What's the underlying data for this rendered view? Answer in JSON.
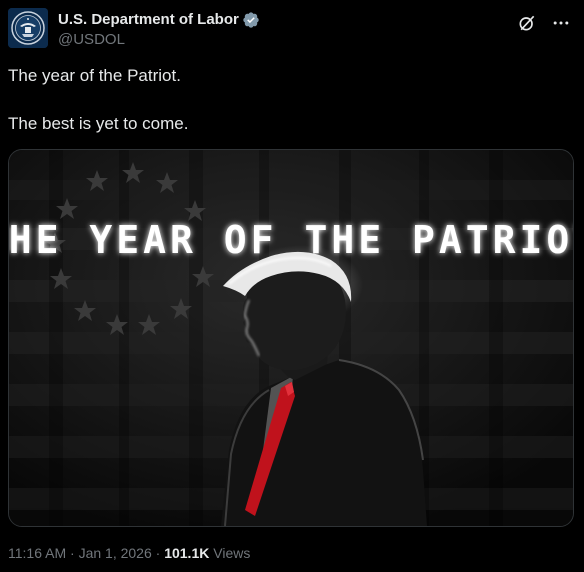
{
  "account": {
    "display_name": "U.S. Department of Labor",
    "handle": "@USDOL",
    "verified_icon": "verified-badge-icon",
    "avatar_icon": "department-of-labor-seal"
  },
  "header_actions": {
    "grok_icon": "grok-icon",
    "more_icon": "more-options-icon"
  },
  "tweet": {
    "line1": "The year of the Patriot.",
    "line2": "The best is yet to come."
  },
  "media": {
    "overlay_text": "THE YEAR OF THE PATRIOT"
  },
  "meta": {
    "time": "11:16 AM",
    "separator1": " · ",
    "date": "Jan 1, 2026",
    "separator2": " · ",
    "views_count": "101.1K",
    "views_label": " Views"
  },
  "colors": {
    "background": "#000000",
    "text_primary": "#e7e9ea",
    "text_secondary": "#71767b",
    "verified_badge": "#829aab",
    "tie_red": "#c0121c"
  }
}
